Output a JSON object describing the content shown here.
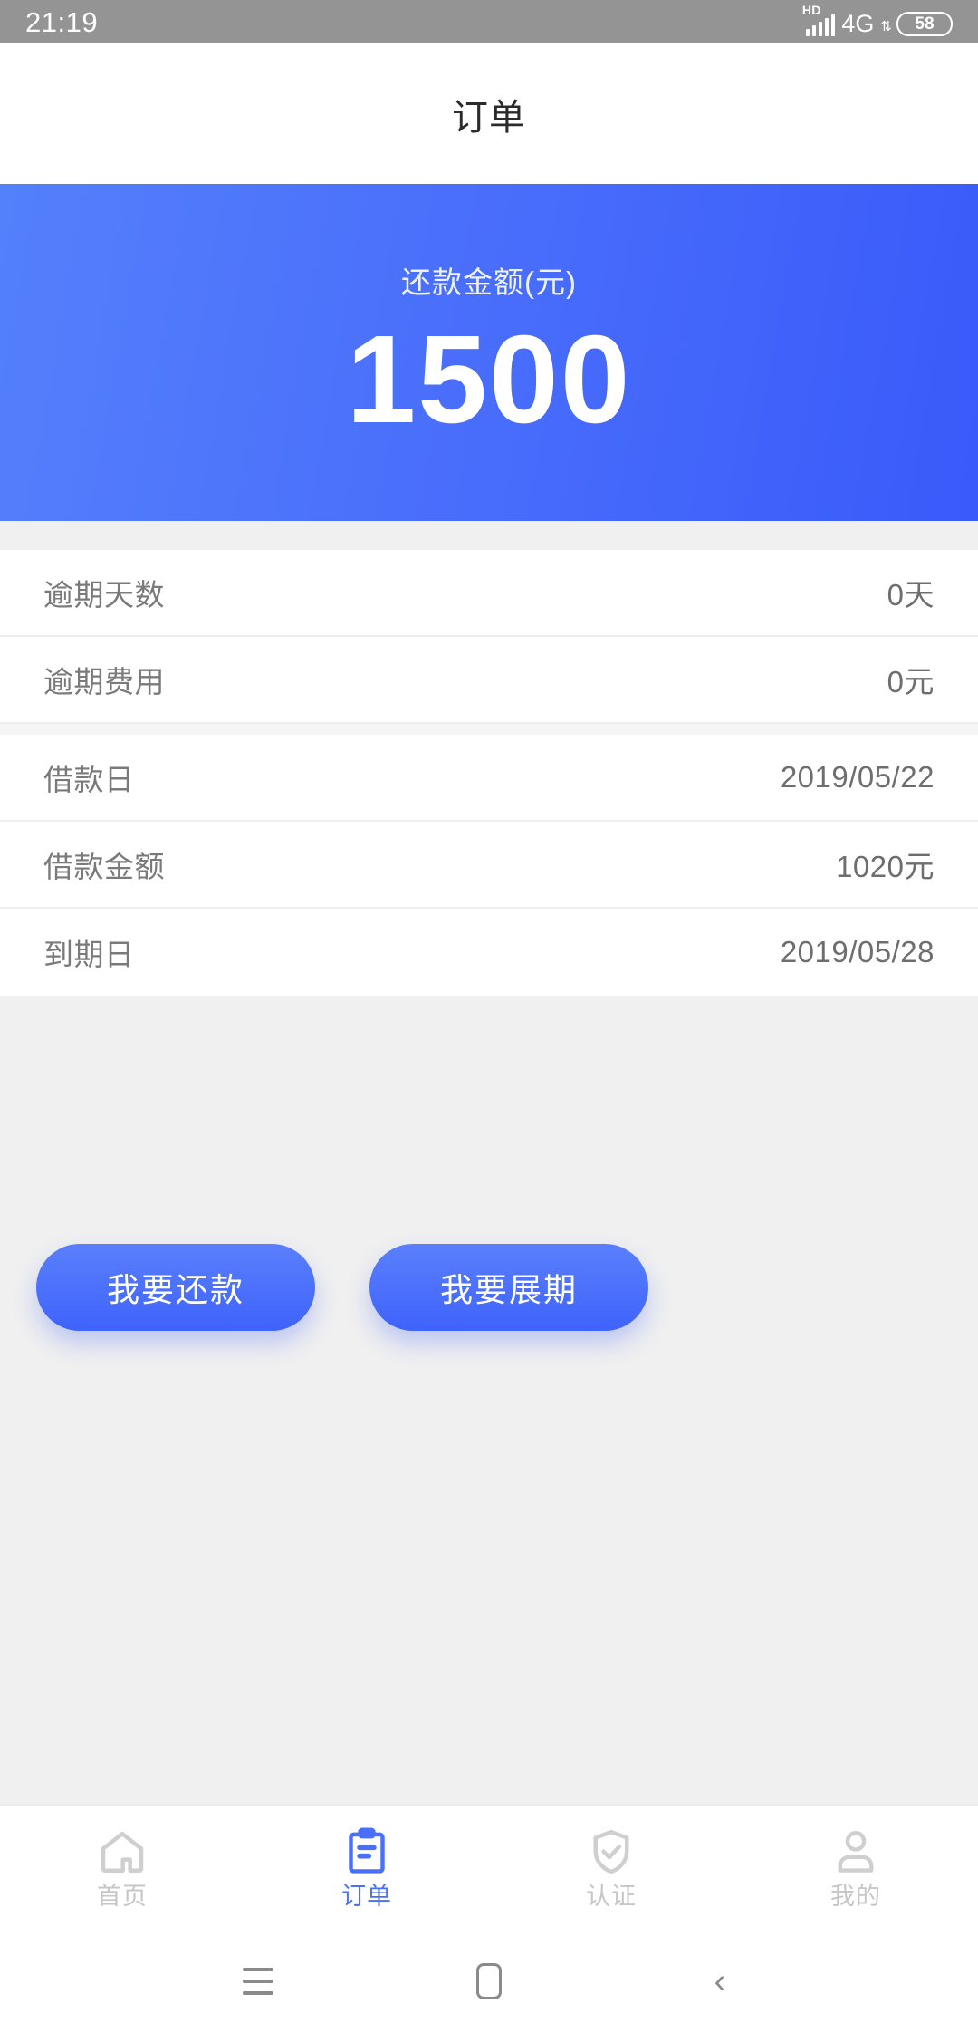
{
  "status_bar": {
    "time": "21:19",
    "hd_label": "HD",
    "network": "4G",
    "data_arrows": "⇅",
    "battery": "58"
  },
  "header": {
    "title": "订单"
  },
  "hero": {
    "label": "还款金额(元)",
    "amount": "1500",
    "gradient_from": "#5380fb",
    "gradient_to": "#3a5afa"
  },
  "details": {
    "rows": [
      {
        "label": "逾期天数",
        "value": "0天"
      },
      {
        "label": "逾期费用",
        "value": "0元"
      },
      {
        "label": "借款日",
        "value": "2019/05/22"
      },
      {
        "label": "借款金额",
        "value": "1020元"
      },
      {
        "label": "到期日",
        "value": "2019/05/28"
      }
    ]
  },
  "actions": {
    "repay_label": "我要还款",
    "extend_label": "我要展期",
    "accent": "#4a6ffb"
  },
  "tabbar": {
    "active_color": "#4a6ffb",
    "inactive_color": "#c6c6c6",
    "items": [
      {
        "label": "首页",
        "icon": "home-icon",
        "active": false
      },
      {
        "label": "订单",
        "icon": "clipboard-icon",
        "active": true
      },
      {
        "label": "认证",
        "icon": "shield-check-icon",
        "active": false
      },
      {
        "label": "我的",
        "icon": "person-icon",
        "active": false
      }
    ]
  },
  "android_nav": {
    "recents": "recents-icon",
    "home": "home-square-icon",
    "back": "‹"
  }
}
